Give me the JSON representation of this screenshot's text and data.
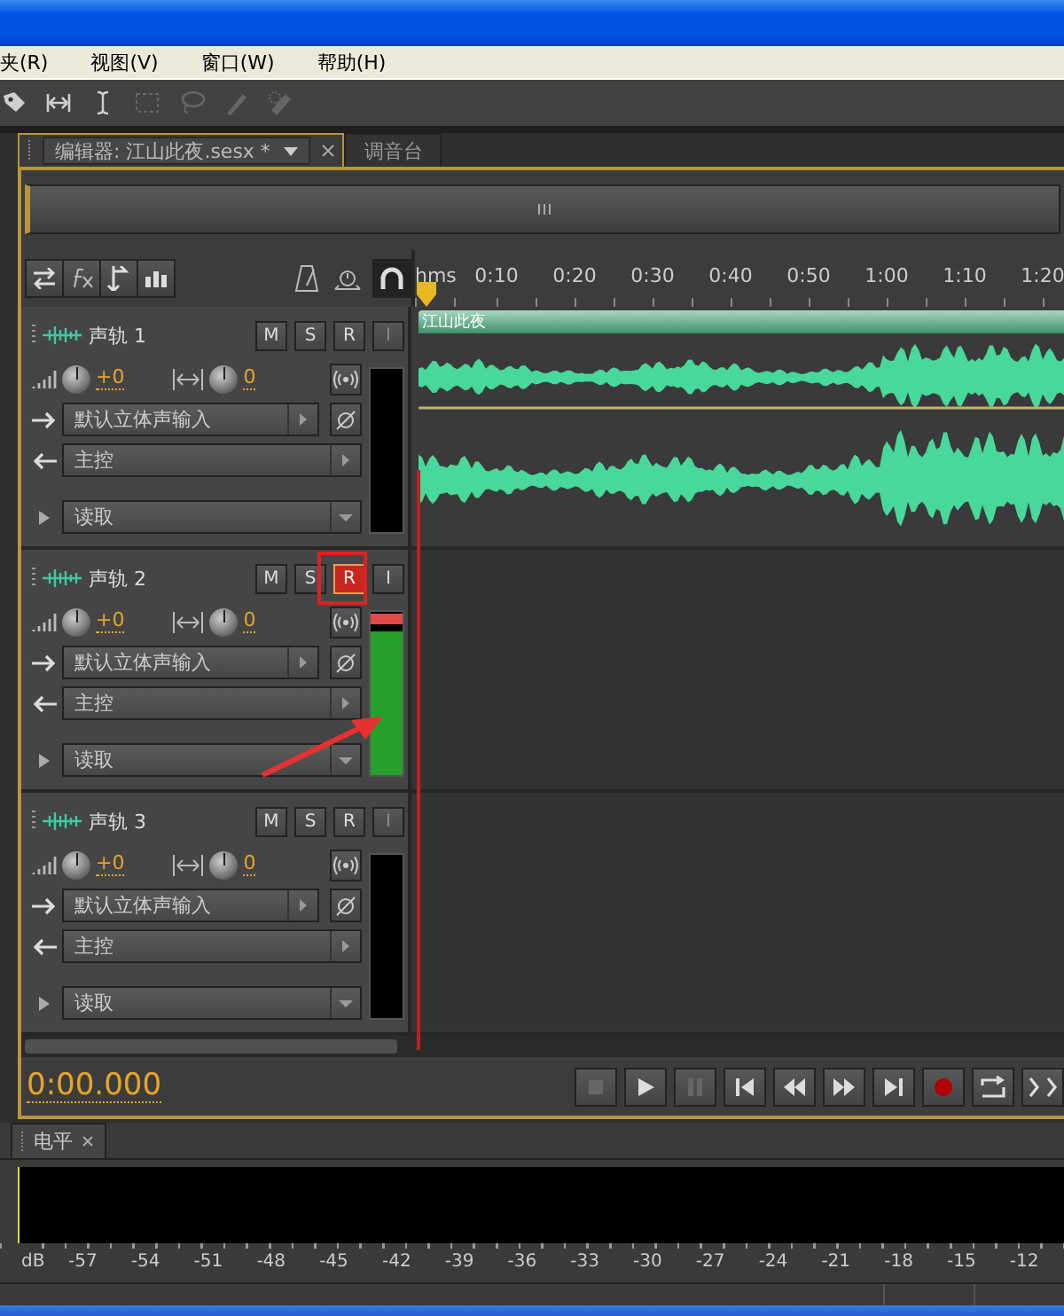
{
  "menu": [
    {
      "label": "夹(R)"
    },
    {
      "label": "视图(V)"
    },
    {
      "label": "窗口(W)"
    },
    {
      "label": "帮助(H)"
    }
  ],
  "tools": [
    {
      "kind": "move",
      "disabled": false
    },
    {
      "kind": "time-selection",
      "disabled": false
    },
    {
      "kind": "cursor",
      "disabled": false
    },
    {
      "kind": "marquee",
      "disabled": true
    },
    {
      "kind": "lasso",
      "disabled": true
    },
    {
      "kind": "brush",
      "disabled": true
    },
    {
      "kind": "heal",
      "disabled": true
    }
  ],
  "editor_tabs": [
    {
      "label": "编辑器: 江山此夜.sesx *",
      "selected": true,
      "kind": "editor"
    },
    {
      "label": "调音台",
      "selected": false,
      "kind": "plain"
    }
  ],
  "ruler": {
    "unit": "hms",
    "labels": [
      "0:10",
      "0:20",
      "0:30",
      "0:40",
      "0:50",
      "1:00",
      "1:10",
      "1:20"
    ]
  },
  "tracks": [
    {
      "name": "声轨 1",
      "buttons": [
        {
          "label": "M",
          "on": false,
          "disabled": false
        },
        {
          "label": "S",
          "on": false,
          "disabled": false
        },
        {
          "label": "R",
          "on": false,
          "disabled": false
        },
        {
          "label": "I",
          "on": false,
          "disabled": true
        }
      ],
      "volume": "+0",
      "pan": "0",
      "input": "默认立体声输入",
      "output": "主控",
      "automation": "读取",
      "meter": {
        "level": 0
      },
      "highlighted": false,
      "clip": {
        "title": "江山此夜"
      }
    },
    {
      "name": "声轨 2",
      "buttons": [
        {
          "label": "M",
          "on": false,
          "disabled": false
        },
        {
          "label": "S",
          "on": false,
          "disabled": false
        },
        {
          "label": "R",
          "on": true,
          "disabled": false
        },
        {
          "label": "I",
          "on": false,
          "disabled": false
        }
      ],
      "volume": "+0",
      "pan": "0",
      "input": "默认立体声输入",
      "output": "主控",
      "automation": "读取",
      "meter": {
        "level": 0.88
      },
      "highlighted": true
    },
    {
      "name": "声轨 3",
      "buttons": [
        {
          "label": "M",
          "on": false,
          "disabled": false
        },
        {
          "label": "S",
          "on": false,
          "disabled": false
        },
        {
          "label": "R",
          "on": false,
          "disabled": false
        },
        {
          "label": "I",
          "on": false,
          "disabled": true
        }
      ],
      "volume": "+0",
      "pan": "0",
      "input": "默认立体声输入",
      "output": "主控",
      "automation": "读取",
      "meter": {
        "level": 0
      },
      "highlighted": false
    }
  ],
  "transport": {
    "time": "0:00.000",
    "buttons": [
      {
        "kind": "stop",
        "disabled": true
      },
      {
        "kind": "play",
        "disabled": false
      },
      {
        "kind": "pause",
        "disabled": true
      },
      {
        "kind": "to-start",
        "disabled": false
      },
      {
        "kind": "rewind",
        "disabled": false
      },
      {
        "kind": "forward",
        "disabled": false
      },
      {
        "kind": "to-end",
        "disabled": false
      },
      {
        "kind": "record",
        "disabled": false
      },
      {
        "kind": "loop",
        "disabled": false
      },
      {
        "kind": "skip",
        "disabled": false
      }
    ]
  },
  "level_panel": {
    "tab": "电平",
    "scale": [
      "dB",
      "-57",
      "-54",
      "-51",
      "-48",
      "-45",
      "-42",
      "-39",
      "-36",
      "-33",
      "-30",
      "-27",
      "-24",
      "-21",
      "-18",
      "-15",
      "-12"
    ]
  }
}
